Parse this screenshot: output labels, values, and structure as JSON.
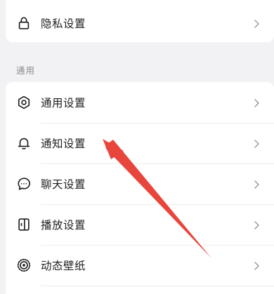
{
  "top_section": {
    "items": [
      {
        "label": "隐私设置",
        "icon": "lock-icon"
      }
    ]
  },
  "general_section": {
    "header": "通用",
    "items": [
      {
        "label": "通用设置",
        "icon": "gear-icon"
      },
      {
        "label": "通知设置",
        "icon": "bell-icon"
      },
      {
        "label": "聊天设置",
        "icon": "chat-bubble-icon"
      },
      {
        "label": "播放设置",
        "icon": "play-device-icon"
      },
      {
        "label": "动态壁纸",
        "icon": "live-wallpaper-icon"
      }
    ]
  },
  "annotation": {
    "color": "#e8463d"
  }
}
